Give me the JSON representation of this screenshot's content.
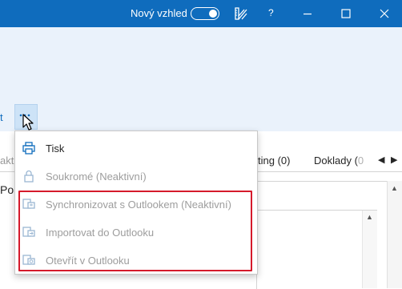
{
  "titlebar": {
    "new_look_label": "Nový vzhled",
    "new_look_enabled": true,
    "help_label": "?"
  },
  "ribbon": {
    "left_fragment": "t"
  },
  "tabs": {
    "left_fragment": "akt",
    "ting_label": "ting (0)",
    "doklady_label": "Doklady (",
    "doklady_fade": "0"
  },
  "panel": {
    "title_fragment": "Po"
  },
  "menu": {
    "items": [
      {
        "label": "Tisk",
        "icon": "printer-icon",
        "enabled": true
      },
      {
        "label": "Soukromé (Neaktivní)",
        "icon": "lock-icon",
        "enabled": false
      },
      {
        "label": "Synchronizovat s Outlookem (Neaktivní)",
        "icon": "outlook-sync-icon",
        "enabled": false
      },
      {
        "label": "Importovat do Outlooku",
        "icon": "outlook-import-icon",
        "enabled": false
      },
      {
        "label": "Otevřít v Outlooku",
        "icon": "outlook-open-icon",
        "enabled": false
      }
    ],
    "highlight_color": "#d51a2b"
  },
  "colors": {
    "titlebar": "#0f6cbd",
    "accent": "#0f6cbd",
    "disabled_text": "#9d9d9d"
  }
}
